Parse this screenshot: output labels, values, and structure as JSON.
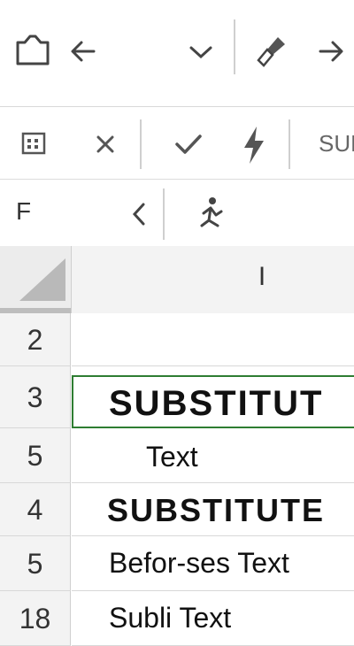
{
  "formula_bar": {
    "fx_preview": "SUE"
  },
  "name_box": {
    "value": "F"
  },
  "column_header": {
    "label": "I"
  },
  "rows": [
    {
      "num": "2",
      "text": ""
    },
    {
      "num": "3",
      "text": "SUBSTITUT"
    },
    {
      "num": "5",
      "text": "Text"
    },
    {
      "num": "4",
      "text": "SUBSTITUTE"
    },
    {
      "num": "5",
      "text": "Befor-ses Text"
    },
    {
      "num": "18",
      "text": "Subli Text"
    }
  ],
  "icons": [
    "clipboard-icon",
    "undo-icon",
    "dropdown-chevron-icon",
    "brush-icon",
    "redo-icon",
    "calculator-icon",
    "cancel-icon",
    "enter-check-icon",
    "flash-fill-icon",
    "collapse-chevron-icon",
    "function-icon"
  ],
  "colors": {
    "selection_border": "#2e7d32",
    "header_bg": "#f3f3f3",
    "separator": "#cfcfcf"
  }
}
